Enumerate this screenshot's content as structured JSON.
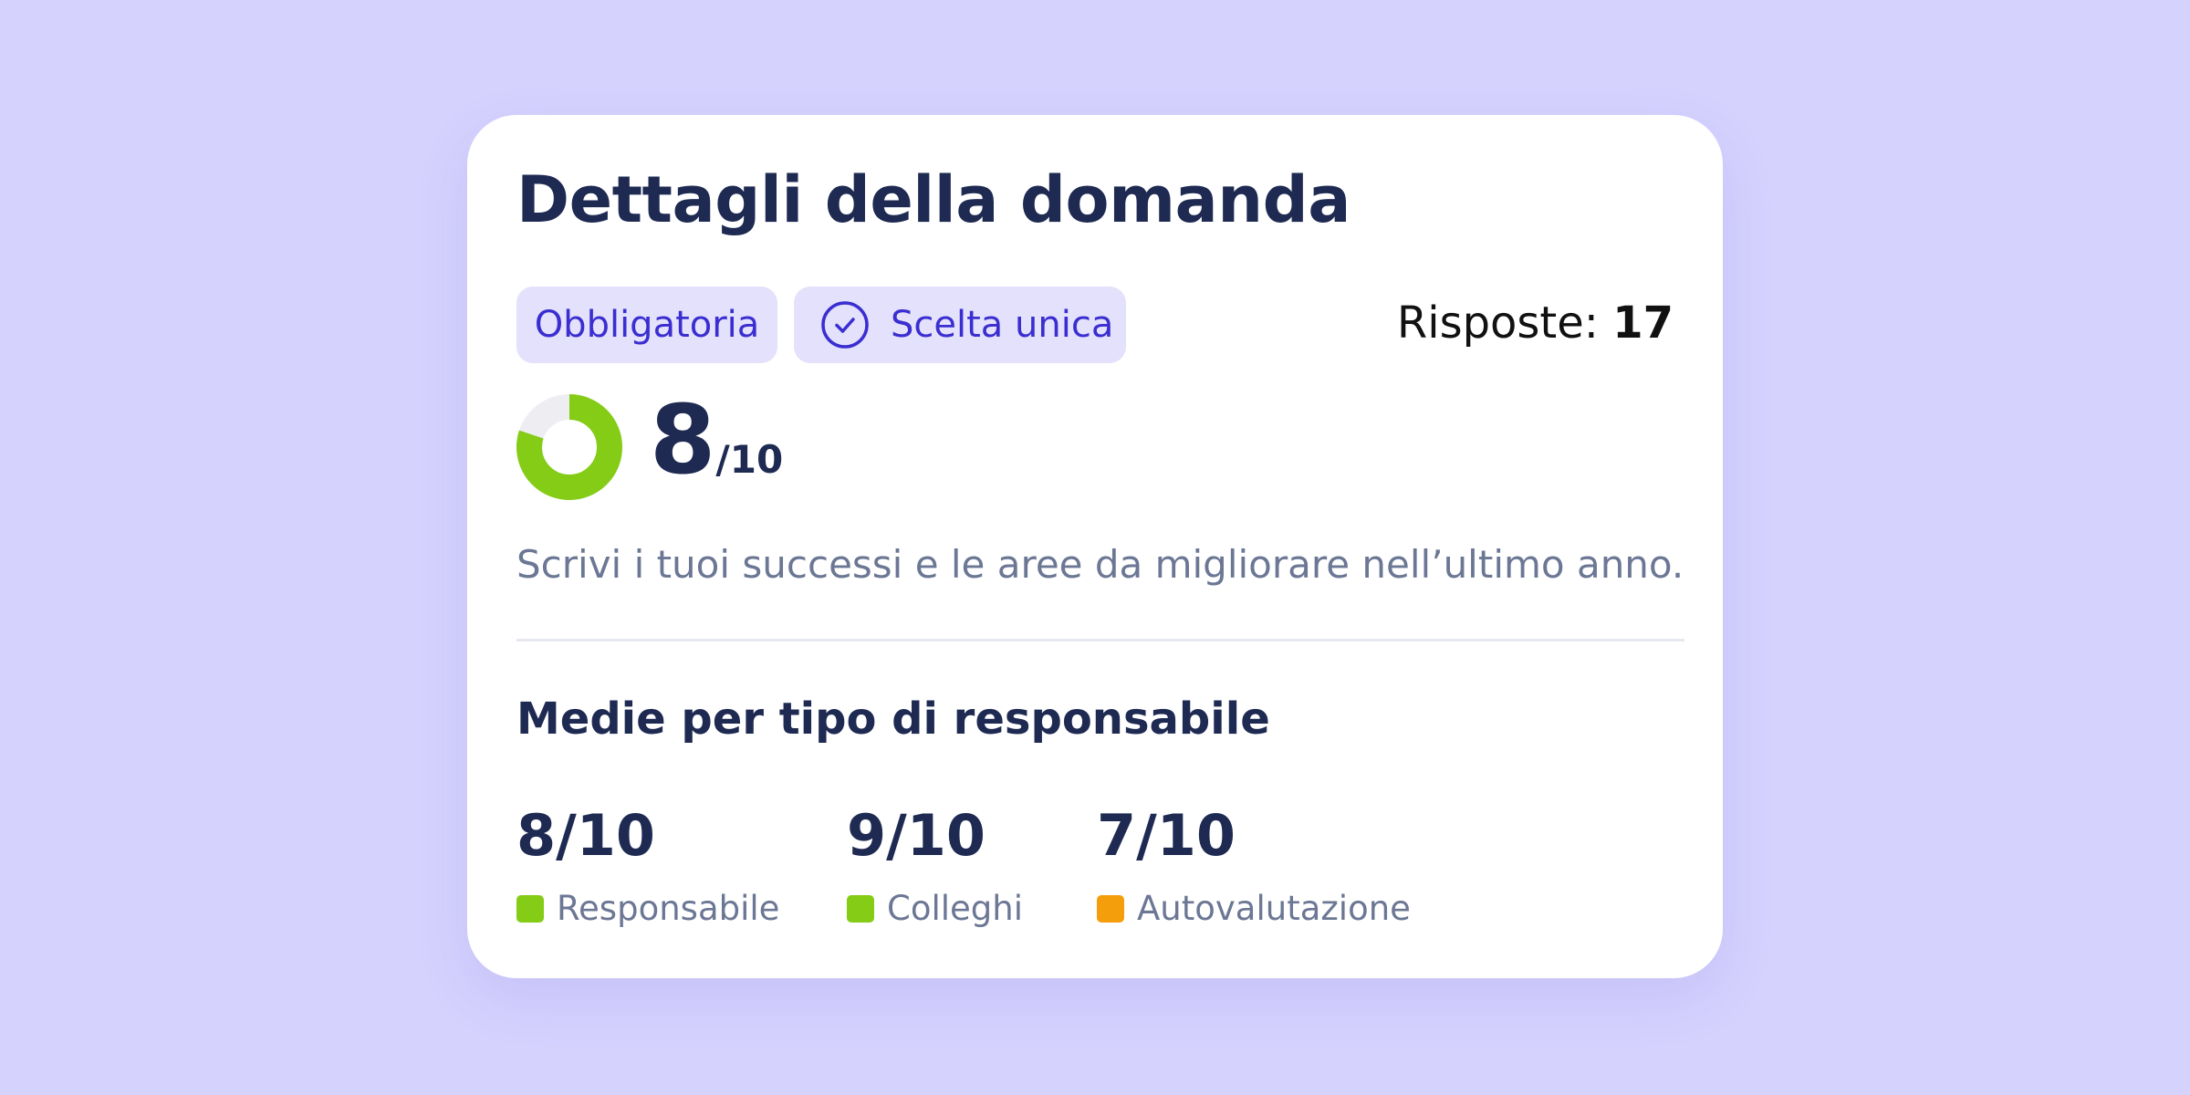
{
  "card": {
    "title": "Dettagli della domanda",
    "chips": [
      {
        "label": "Obbligatoria"
      },
      {
        "label": "Scelta unica",
        "icon": "check-circle-icon"
      }
    ],
    "responses": {
      "label": "Risposte:",
      "count": "17"
    },
    "score": {
      "value": "8",
      "denominator": "/10",
      "fraction": 0.8,
      "color": "#84cc16",
      "track_color": "#eeeef2"
    },
    "description": "Scrivi i tuoi successi e le aree da migliorare nell’ultimo anno.",
    "averages": {
      "title": "Medie per tipo di responsabile",
      "items": [
        {
          "value": "8/10",
          "label": "Responsabile",
          "color": "#84cc16"
        },
        {
          "value": "9/10",
          "label": "Colleghi",
          "color": "#84cc16"
        },
        {
          "value": "7/10",
          "label": "Autovalutazione",
          "color": "#f59e0b"
        }
      ]
    }
  }
}
